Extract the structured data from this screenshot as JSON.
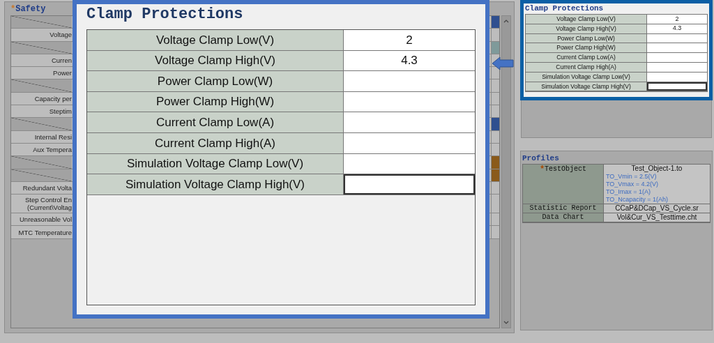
{
  "safety": {
    "title": "Safety",
    "marker": "*",
    "rows": [
      {
        "kind": "blank",
        "color": "#2f4f8f"
      },
      {
        "kind": "label",
        "label": "Voltage"
      },
      {
        "kind": "blank",
        "color": "#7f9a9a"
      },
      {
        "kind": "label",
        "label": "Curren"
      },
      {
        "kind": "label",
        "label": "Power"
      },
      {
        "kind": "blank"
      },
      {
        "kind": "label",
        "label": "Capacity per"
      },
      {
        "kind": "label",
        "label": "Steptim"
      },
      {
        "kind": "blank",
        "color": "#2f4f8f"
      },
      {
        "kind": "label",
        "label": "Internal Resi"
      },
      {
        "kind": "label",
        "label": "Aux Tempera"
      },
      {
        "kind": "blank",
        "color": "#8a5a1a"
      },
      {
        "kind": "blank",
        "color": "#8a5a1a"
      },
      {
        "kind": "label",
        "label": "Redundant Volta"
      },
      {
        "kind": "label",
        "label": "Step Control En\n(Current\\Voltag"
      },
      {
        "kind": "label",
        "label": "Unreasonable Vol"
      },
      {
        "kind": "label",
        "label": "MTC Temperature"
      }
    ]
  },
  "callout": {
    "title": "Clamp Protections",
    "rows": [
      {
        "label": "Voltage Clamp Low(V)",
        "value": "2",
        "focused": false
      },
      {
        "label": "Voltage Clamp High(V)",
        "value": "4.3",
        "focused": false
      },
      {
        "label": "Power Clamp Low(W)",
        "focused": false
      },
      {
        "label": "Power Clamp High(W)",
        "focused": false
      },
      {
        "label": "Current Clamp Low(A)",
        "focused": false
      },
      {
        "label": "Current Clamp High(A)",
        "focused": false
      },
      {
        "label": "Simulation Voltage Clamp Low(V)",
        "focused": false
      },
      {
        "label": "Simulation Voltage Clamp High(V)",
        "focused": true
      }
    ]
  },
  "clamp_panel": {
    "title": "Clamp Protections",
    "rows": [
      {
        "label": "Voltage Clamp Low(V)",
        "value": "2",
        "focused": false
      },
      {
        "label": "Voltage Clamp High(V)",
        "value": "4.3",
        "focused": false
      },
      {
        "label": "Power Clamp Low(W)",
        "focused": false
      },
      {
        "label": "Power Clamp High(W)",
        "focused": false
      },
      {
        "label": "Current Clamp Low(A)",
        "focused": false
      },
      {
        "label": "Current Clamp High(A)",
        "focused": false
      },
      {
        "label": "Simulation Voltage Clamp Low(V)",
        "focused": false
      },
      {
        "label": "Simulation Voltage Clamp High(V)",
        "focused": true
      }
    ]
  },
  "profiles": {
    "title": "Profiles",
    "rows": [
      {
        "label": "TestObject",
        "marker": "*",
        "value": "Test_Object-1.to",
        "details": [
          "TO_Vmin = 2.5(V)",
          "TO_Vmax = 4.2(V)",
          "TO_Imax = 1(A)",
          "TO_Ncapacity = 1(Ah)"
        ]
      },
      {
        "label": "Statistic Report",
        "value": "CCaP&DCap_VS_Cycle.sr"
      },
      {
        "label": "Data Chart",
        "value": "Vol&Cur_VS_Testtime.cht"
      }
    ]
  }
}
